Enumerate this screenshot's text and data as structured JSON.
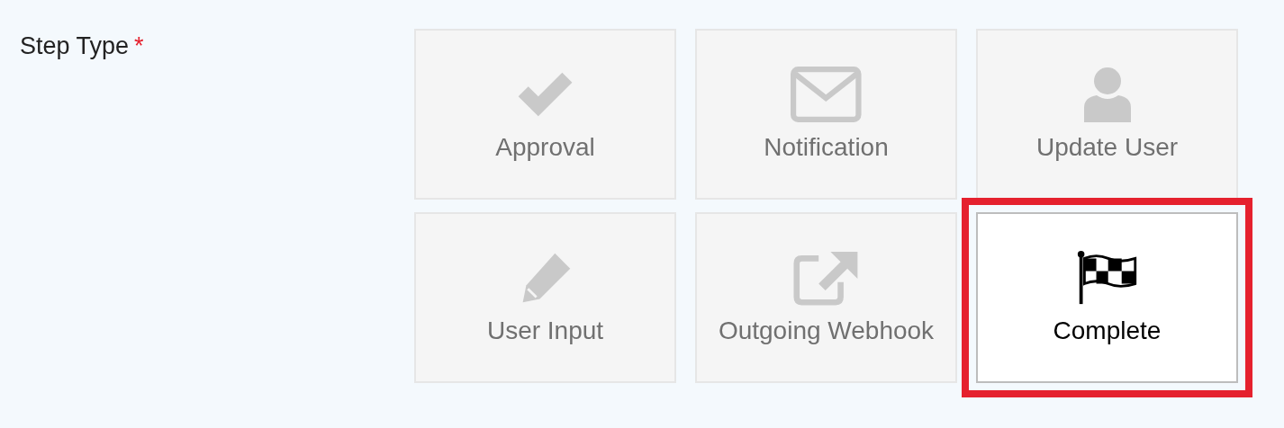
{
  "field": {
    "label": "Step Type",
    "required_mark": "*"
  },
  "options": [
    {
      "label": "Approval",
      "selected": false
    },
    {
      "label": "Notification",
      "selected": false
    },
    {
      "label": "Update User",
      "selected": false
    },
    {
      "label": "User Input",
      "selected": false
    },
    {
      "label": "Outgoing Webhook",
      "selected": false
    },
    {
      "label": "Complete",
      "selected": true
    }
  ]
}
